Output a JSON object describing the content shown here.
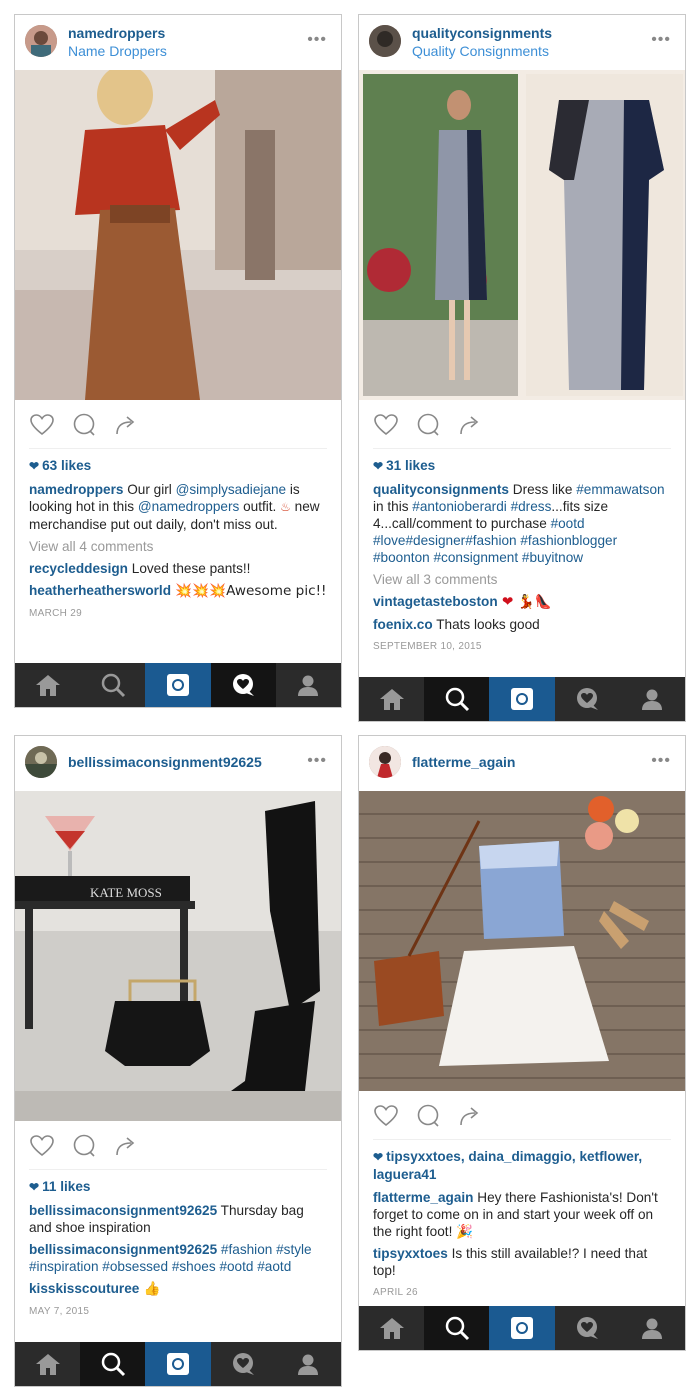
{
  "posts": [
    {
      "username": "namedroppers",
      "subtitle": "Name Droppers",
      "likes": "63 likes",
      "caption": {
        "user": "namedroppers",
        "t1": " Our girl ",
        "mention1": "@simplysadiejane",
        "t2": " is looking hot in this ",
        "mention2": "@namedroppers",
        "t3": " outfit. ",
        "emoji": "♨",
        "t4": " new merchandise put out daily, don't miss out."
      },
      "view_all": "View all 4 comments",
      "comments": [
        {
          "user": "recycleddesign",
          "text": " Loved these pants!!"
        },
        {
          "user": "heatherheathersworld",
          "text": " 💥💥💥Awesome pic!!"
        }
      ],
      "date": "MARCH 29"
    },
    {
      "username": "qualityconsignments",
      "subtitle": "Quality Consignments",
      "likes": "31 likes",
      "caption": {
        "user": "qualityconsignments",
        "t1": " Dress like ",
        "tag1": "#emmawatson",
        "t2": " in this ",
        "tag2": "#antonioberardi",
        "tag3": "#dress",
        "t3": "...fits size 4...call/comment to purchase ",
        "tag4": "#ootd #love#designer#fashion #fashionblogger #boonton #consignment #buyitnow"
      },
      "view_all": "View all 3 comments",
      "comments": [
        {
          "user": "vintagetasteboston",
          "text": " ❤ 💃👠"
        },
        {
          "user": "foenix.co",
          "text": " Thats looks good"
        }
      ],
      "date": "SEPTEMBER 10, 2015"
    },
    {
      "username": "bellissimaconsignment92625",
      "likes": "11 likes",
      "caption": {
        "user": "bellissimaconsignment92625",
        "t1": " Thursday bag and shoe inspiration"
      },
      "comments": [
        {
          "user": "bellissimaconsignment92625",
          "tags": " #fashion #style #inspiration #obsessed #shoes #ootd #aotd"
        },
        {
          "user": "kisskisscouturee",
          "text": " 👍"
        }
      ],
      "photo_text": "KATE MOSS",
      "date": "MAY 7, 2015"
    },
    {
      "username": "flatterme_again",
      "likes": "tipsyxxtoes, daina_dimaggio, ketflower, laguera41",
      "caption": {
        "user": "flatterme_again",
        "t1": " Hey there Fashionista's! Don't forget to come on in and start your week off on the right foot! 🎉"
      },
      "comments": [
        {
          "user": "tipsyxxtoes",
          "text": " Is this still available!? I need that top!"
        }
      ],
      "date": "APRIL 26"
    }
  ],
  "colors": {
    "link": "#1d5d8f",
    "tab_active": "#1b5a91",
    "tab_bg": "#2b2b2b"
  },
  "icons": [
    "heart-icon",
    "comment-icon",
    "share-icon",
    "home-icon",
    "search-icon",
    "camera-icon",
    "activity-icon",
    "profile-icon"
  ]
}
